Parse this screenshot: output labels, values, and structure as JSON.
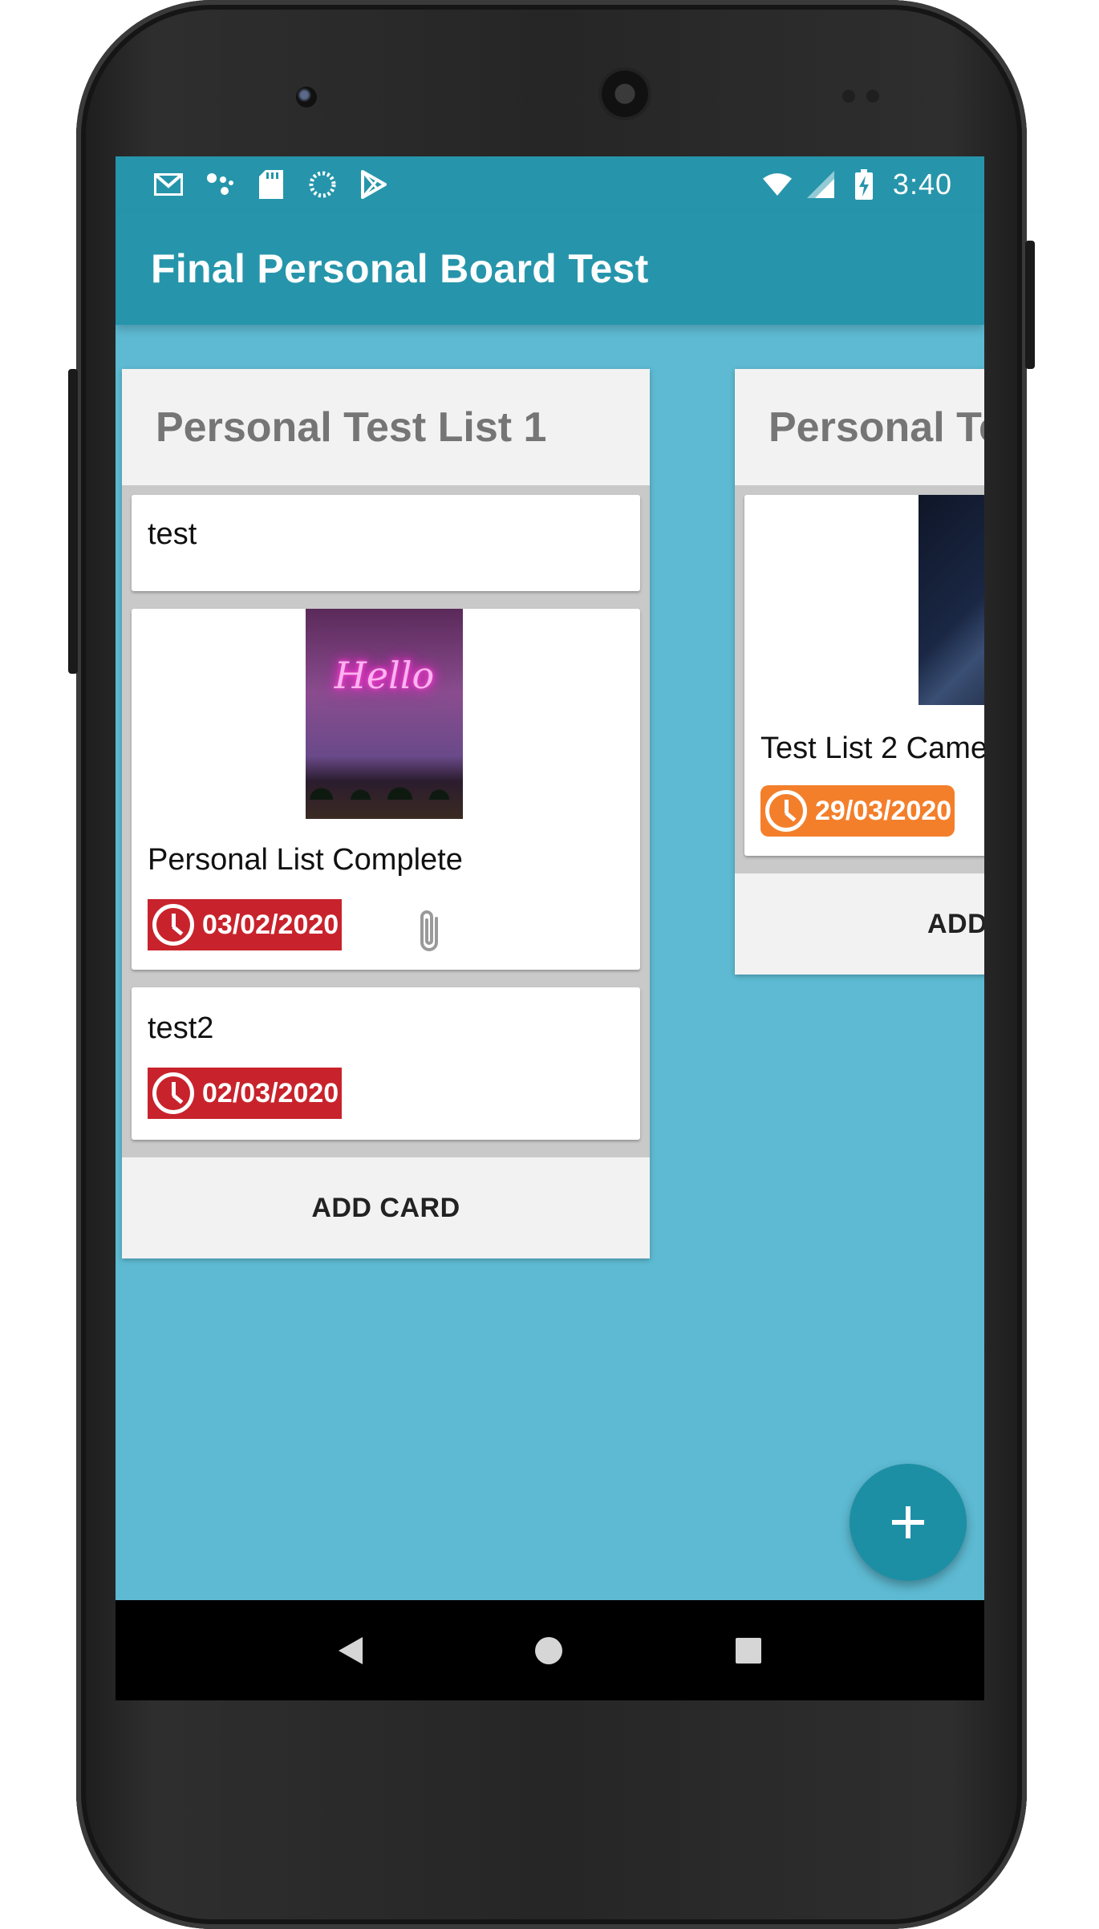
{
  "status_bar": {
    "time": "3:40",
    "left_icons": [
      "gmail-icon",
      "dots-icon",
      "sd-card-icon",
      "sync-icon",
      "play-store-icon"
    ],
    "right_icons": [
      "wifi-icon",
      "signal-icon",
      "battery-charging-icon"
    ]
  },
  "app_bar": {
    "title": "Final Personal Board Test"
  },
  "lists": [
    {
      "title": "Personal Test List 1",
      "cards": [
        {
          "title": "test"
        },
        {
          "title": "Personal List Complete",
          "image": "neon-hello-image",
          "image_text": "Hello",
          "due": "03/02/2020",
          "due_status": "overdue",
          "has_attachment": true
        },
        {
          "title": "test2",
          "due": "02/03/2020",
          "due_status": "overdue"
        }
      ],
      "add_card_label": "ADD CARD"
    },
    {
      "title": "Personal Te",
      "cards": [
        {
          "title": "Test List 2 Came",
          "image": "dark-room-image",
          "due": "29/03/2020",
          "due_status": "due-soon"
        }
      ],
      "add_card_label": "ADD"
    }
  ],
  "fab": {
    "icon": "plus-icon"
  },
  "nav_bar": {
    "icons": [
      "back-icon",
      "home-icon",
      "recents-icon"
    ]
  },
  "colors": {
    "primary": "#2695ab",
    "board_background": "#5dbad2",
    "due_overdue": "#c8232c",
    "due_soon": "#f47f2b",
    "fab": "#1d8fa5"
  }
}
